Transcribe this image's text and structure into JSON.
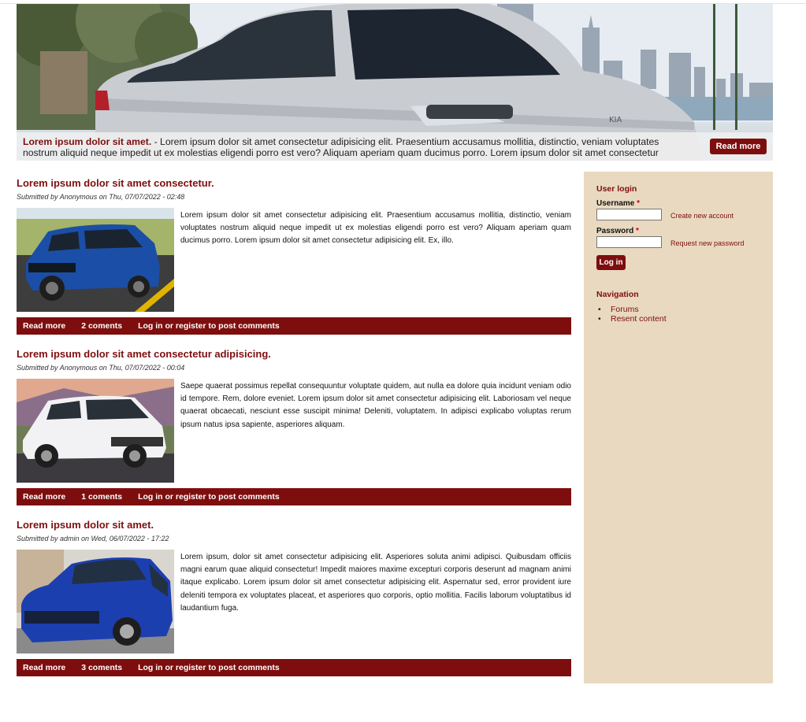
{
  "hero": {
    "title": "Lorem ipsum dolor sit amet.",
    "text": " - Lorem ipsum dolor sit amet consectetur adipisicing elit. Praesentium accusamus mollitia, distinctio, veniam voluptates nostrum aliquid neque impedit ut ex molestias eligendi porro est vero? Aliquam aperiam quam ducimus porro. Lorem ipsum dolor sit amet consectetur",
    "button": "Read more"
  },
  "articles": [
    {
      "title": "Lorem ipsum dolor sit amet consectetur.",
      "meta": "Submitted by Anonymous on Thu, 07/07/2022 - 02:48",
      "body": "Lorem ipsum dolor sit amet consectetur adipisicing elit. Praesentium accusamus mollitia, distinctio, veniam voluptates nostrum aliquid neque impedit ut ex molestias eligendi porro est vero? Aliquam aperiam quam ducimus porro. Lorem ipsum dolor sit amet consectetur adipisicing elit. Ex, illo.",
      "read_more": "Read more",
      "comments": "2 coments",
      "login": "Log in or register to post comments"
    },
    {
      "title": "Lorem ipsum dolor sit amet consectetur adipisicing.",
      "meta": "Submitted by Anonymous on Thu, 07/07/2022 - 00:04",
      "body": "Saepe quaerat possimus repellat consequuntur voluptate quidem, aut nulla ea dolore quia incidunt veniam odio id tempore. Rem, dolore eveniet. Lorem ipsum dolor sit amet consectetur adipisicing elit. Laboriosam vel neque quaerat obcaecati, nesciunt esse suscipit minima! Deleniti, voluptatem. In adipisci explicabo voluptas rerum ipsum natus ipsa sapiente, asperiores aliquam.",
      "read_more": "Read more",
      "comments": "1 coments",
      "login": "Log in or register to post comments"
    },
    {
      "title": "Lorem ipsum dolor sit amet.",
      "meta": "Submitted by admin on Wed, 06/07/2022 - 17:22",
      "body": "Lorem ipsum, dolor sit amet consectetur adipisicing elit. Asperiores soluta animi adipisci. Quibusdam officiis magni earum quae aliquid consectetur! Impedit maiores maxime excepturi corporis deserunt ad magnam animi itaque explicabo. Lorem ipsum dolor sit amet consectetur adipisicing elit. Aspernatur sed, error provident iure deleniti tempora ex voluptates placeat, et asperiores quo corporis, optio mollitia. Facilis laborum voluptatibus id laudantium fuga.",
      "read_more": "Read more",
      "comments": "3 coments",
      "login": "Log in or register to post comments"
    }
  ],
  "sidebar": {
    "login_heading": "User login",
    "username_label": "Username",
    "password_label": "Password",
    "required_marker": "*",
    "username_value": "",
    "password_value": "",
    "create_account": "Create new account",
    "request_password": "Request new password",
    "login_button": "Log in",
    "nav_heading": "Navigation",
    "nav_items": [
      "Forums",
      "Resent content"
    ]
  },
  "colors": {
    "brand": "#7e0e0e",
    "sidebar_bg": "#e8d9c0"
  }
}
